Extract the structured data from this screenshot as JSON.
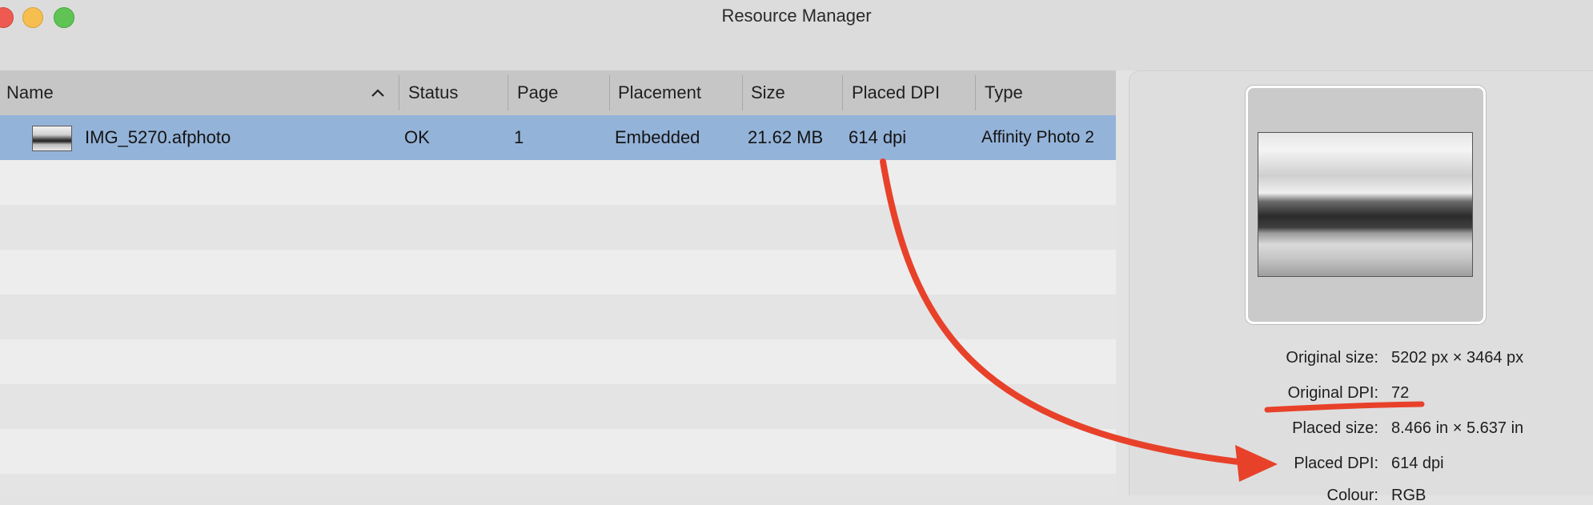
{
  "window": {
    "title": "Resource Manager"
  },
  "table": {
    "columns": [
      "Name",
      "Status",
      "Page",
      "Placement",
      "Size",
      "Placed DPI",
      "Type"
    ],
    "sort_icon": "chevron-up-icon",
    "rows": [
      {
        "name": "IMG_5270.afphoto",
        "status": "OK",
        "page": "1",
        "placement": "Embedded",
        "size": "21.62 MB",
        "placed_dpi": "614 dpi",
        "type": "Affinity Photo 2",
        "selected": true
      }
    ]
  },
  "details": {
    "original_size_label": "Original size:",
    "original_size_value": "5202 px × 3464 px",
    "original_dpi_label": "Original DPI:",
    "original_dpi_value": "72",
    "placed_size_label": "Placed size:",
    "placed_size_value": "8.466 in × 5.637 in",
    "placed_dpi_label": "Placed DPI:",
    "placed_dpi_value": "614 dpi",
    "colour_label": "Colour:",
    "colour_value": "RGB"
  },
  "colors": {
    "selection": "#94b3d9",
    "annotation": "#e8412a"
  }
}
